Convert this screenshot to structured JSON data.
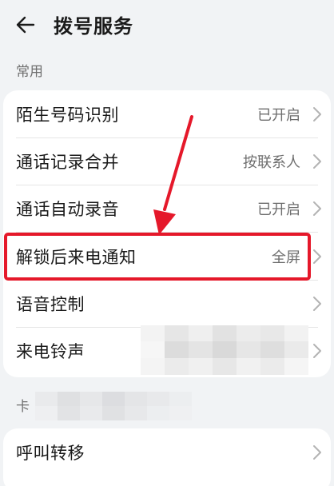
{
  "header": {
    "back_icon": "arrow-left-icon",
    "title": "拨号服务"
  },
  "section_common": {
    "label": "常用",
    "items": [
      {
        "label": "陌生号码识别",
        "value": "已开启",
        "icon": "chevron-right-icon"
      },
      {
        "label": "通话记录合并",
        "value": "按联系人",
        "icon": "chevron-right-icon"
      },
      {
        "label": "通话自动录音",
        "value": "已开启",
        "icon": "chevron-right-icon"
      },
      {
        "label": "解锁后来电通知",
        "value": "全屏",
        "icon": "chevron-right-icon"
      },
      {
        "label": "语音控制",
        "value": "",
        "icon": "chevron-right-icon"
      },
      {
        "label": "来电铃声",
        "value": "",
        "icon": "chevron-right-icon"
      }
    ]
  },
  "section_card": {
    "label": "卡",
    "items": [
      {
        "label": "呼叫转移",
        "value": "",
        "icon": "chevron-right-icon"
      }
    ]
  },
  "annotation": {
    "highlight_color": "#e5182a"
  }
}
